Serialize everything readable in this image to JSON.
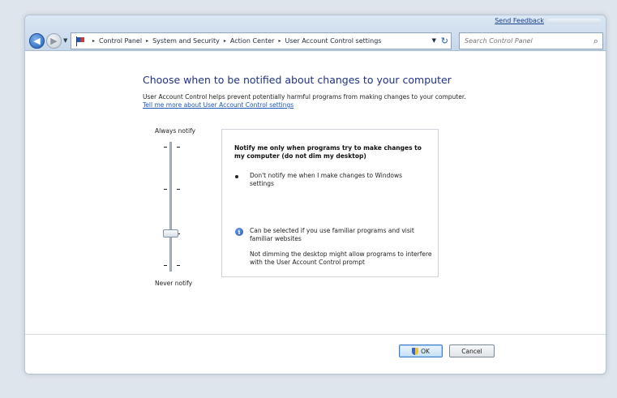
{
  "window": {
    "feedback_link": "Send Feedback"
  },
  "nav": {
    "back_glyph": "◀",
    "forward_glyph": "▶",
    "recent_glyph": "▼"
  },
  "address_bar": {
    "crumbs": [
      "Control Panel",
      "System and Security",
      "Action Center",
      "User Account Control settings"
    ],
    "separator": "▸",
    "dropdown_glyph": "▼",
    "refresh_glyph": "↻"
  },
  "search": {
    "placeholder": "Search Control Panel",
    "icon_glyph": "⌕"
  },
  "main": {
    "heading": "Choose when to be notified about changes to your computer",
    "description": "User Account Control helps prevent potentially harmful programs from making changes to your computer.",
    "learn_more_link": "Tell me more about User Account Control settings"
  },
  "slider": {
    "top_label": "Always notify",
    "bottom_label": "Never notify",
    "levels": 4,
    "selected_level": 3,
    "selected_level_note": "3 of 4 from top"
  },
  "panel": {
    "title": "Notify me only when programs try to make changes to my computer (do not dim my desktop)",
    "bullet": "Don't notify me when I make changes to Windows settings",
    "info_line1": "Can be selected if you use familiar programs and visit familiar websites",
    "info_line2": "Not dimming the desktop might allow programs to interfere with the User Account Control prompt",
    "info_icon_glyph": "i"
  },
  "buttons": {
    "ok": "OK",
    "cancel": "Cancel"
  },
  "colors": {
    "heading": "#1e3287",
    "link": "#1f56b8",
    "ok_highlight": "#3d7cc9"
  }
}
